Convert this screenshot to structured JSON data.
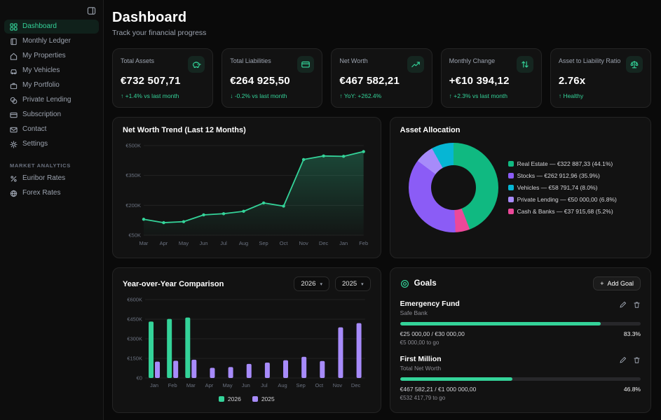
{
  "ui": {
    "accent": "#34d399",
    "icons": {
      "plus": "+",
      "chevron_down": "▾"
    }
  },
  "sidebar": {
    "items": [
      {
        "label": "Dashboard"
      },
      {
        "label": "Monthly Ledger"
      },
      {
        "label": "My Properties"
      },
      {
        "label": "My Vehicles"
      },
      {
        "label": "My Portfolio"
      },
      {
        "label": "Private Lending"
      },
      {
        "label": "Subscription"
      },
      {
        "label": "Contact"
      },
      {
        "label": "Settings"
      }
    ],
    "section_label": "MARKET ANALYTICS",
    "analytics_items": [
      {
        "label": "Euribor Rates"
      },
      {
        "label": "Forex Rates"
      }
    ]
  },
  "header": {
    "title": "Dashboard",
    "subtitle": "Track your financial progress"
  },
  "stats": [
    {
      "label": "Total Assets",
      "value": "€732 507,71",
      "arrow": "↑",
      "delta": "+1.4% vs last month"
    },
    {
      "label": "Total Liabilities",
      "value": "€264 925,50",
      "arrow": "↓",
      "delta": "-0.2% vs last month"
    },
    {
      "label": "Net Worth",
      "value": "€467 582,21",
      "arrow": "↑",
      "delta": "YoY: +262.4%"
    },
    {
      "label": "Monthly Change",
      "value": "+€10 394,12",
      "arrow": "↑",
      "delta": "+2.3% vs last month"
    },
    {
      "label": "Asset to Liability Ratio",
      "value": "2.76x",
      "arrow": "↑",
      "delta": "Healthy"
    }
  ],
  "yoy": {
    "select_primary": "2026",
    "select_secondary": "2025"
  },
  "goals": {
    "title": "Goals",
    "add_label": "Add Goal",
    "items": [
      {
        "name": "Emergency Fund",
        "source": "Safe Bank",
        "amounts": "€25 000,00 / €30 000,00",
        "percent": 83.3,
        "percent_label": "83.3%",
        "remaining": "€5 000,00 to go"
      },
      {
        "name": "First Million",
        "source": "Total Net Worth",
        "amounts": "€467 582,21 / €1 000 000,00",
        "percent": 46.8,
        "percent_label": "46.8%",
        "remaining": "€532 417,79 to go"
      }
    ]
  },
  "chart_data": [
    {
      "id": "net_worth_trend",
      "type": "line",
      "title": "Net Worth Trend (Last 12 Months)",
      "x": [
        "Mar",
        "Apr",
        "May",
        "Jun",
        "Jul",
        "Aug",
        "Sep",
        "Oct",
        "Nov",
        "Dec",
        "Jan",
        "Feb"
      ],
      "values": [
        130000,
        113000,
        118000,
        152000,
        158000,
        170000,
        212000,
        196000,
        430000,
        448000,
        446000,
        470000
      ],
      "y_ticks": [
        "€500K",
        "€350K",
        "€200K",
        "€50K"
      ],
      "y_tick_values": [
        500000,
        350000,
        200000,
        50000
      ],
      "ylim": [
        50000,
        500000
      ],
      "line_color": "#34d399",
      "grid": true
    },
    {
      "id": "asset_allocation",
      "type": "pie",
      "title": "Asset Allocation",
      "slices": [
        {
          "label": "Real Estate",
          "amount": "€322 887,33",
          "percent": 44.1,
          "color": "#10b981"
        },
        {
          "label": "Stocks",
          "amount": "€262 912,96",
          "percent": 35.9,
          "color": "#8b5cf6"
        },
        {
          "label": "Vehicles",
          "amount": "€58 791,74",
          "percent": 8.0,
          "color": "#06b6d4"
        },
        {
          "label": "Private Lending",
          "amount": "€50 000,00",
          "percent": 6.8,
          "color": "#a78bfa"
        },
        {
          "label": "Cash & Banks",
          "amount": "€37 915,68",
          "percent": 5.2,
          "color": "#ec4899"
        }
      ],
      "legend_position": "right"
    },
    {
      "id": "yoy_comparison",
      "type": "bar",
      "title": "Year-over-Year Comparison",
      "categories": [
        "Jan",
        "Feb",
        "Mar",
        "Apr",
        "May",
        "Jun",
        "Jul",
        "Aug",
        "Sep",
        "Oct",
        "Nov",
        "Dec"
      ],
      "series": [
        {
          "name": "2026",
          "color": "#34d399",
          "values": [
            432000,
            452000,
            463000,
            0,
            0,
            0,
            0,
            0,
            0,
            0,
            0,
            0
          ]
        },
        {
          "name": "2025",
          "color": "#a78bfa",
          "values": [
            125000,
            132000,
            140000,
            78000,
            84000,
            108000,
            118000,
            136000,
            162000,
            130000,
            388000,
            420000
          ]
        }
      ],
      "y_ticks": [
        "€600K",
        "€450K",
        "€300K",
        "€150K",
        "€0"
      ],
      "y_tick_values": [
        600000,
        450000,
        300000,
        150000,
        0
      ],
      "ylim": [
        0,
        600000
      ],
      "legend_position": "bottom"
    }
  ]
}
